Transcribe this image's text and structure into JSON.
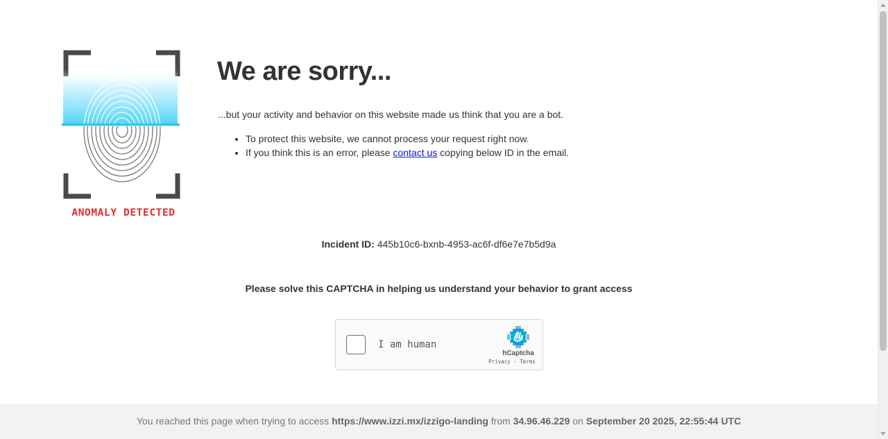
{
  "logo": {
    "caption": "ANOMALY DETECTED",
    "icon": "fingerprint-scan-icon",
    "caption_color": "#e02d2d"
  },
  "content": {
    "title": "We are sorry...",
    "intro": "...but your activity and behavior on this website made us think that you are a bot.",
    "bullet1": "To protect this website, we cannot process your request right now.",
    "bullet2_before": "If you think this is an error, please ",
    "bullet2_link": "contact us",
    "bullet2_after": " copying below ID in the email.",
    "link_color": "#0b18c9"
  },
  "incident": {
    "label": "Incident ID:",
    "value": " 445b10c6-bxnb-4953-ac6f-df6e7e7b5d9a"
  },
  "captcha": {
    "prompt": "Please solve this CAPTCHA in helping us understand your behavior to grant access",
    "checkbox_label": "I am human",
    "brand": "hCaptcha",
    "privacy": "Privacy",
    "separator": " - ",
    "terms": "Terms",
    "logo_icon": "hcaptcha-hand-icon",
    "accent": "#0074bf"
  },
  "footer": {
    "text1": "You reached this page when trying to access ",
    "url": "https://www.izzi.mx/izzigo-landing",
    "text2": " from ",
    "ip": "34.96.46.229",
    "text3": " on ",
    "datetime": "September 20 2025, 22:55:44 UTC"
  }
}
